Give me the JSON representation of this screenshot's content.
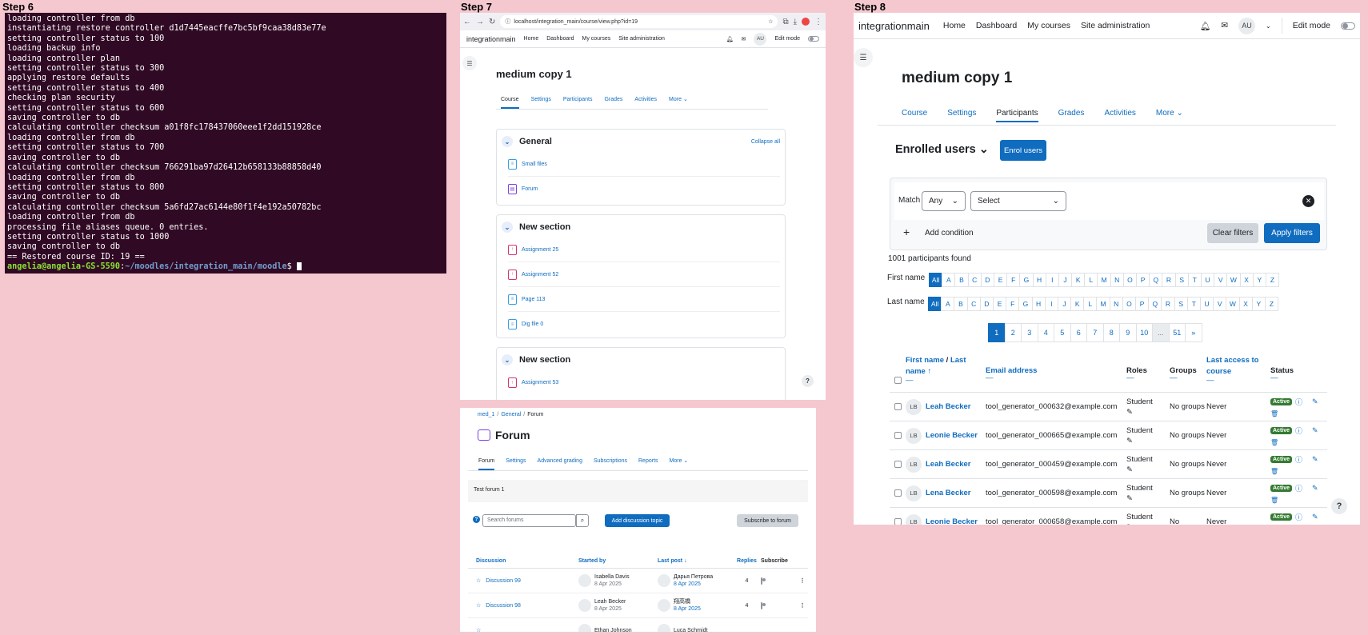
{
  "steps": {
    "s6": "Step 6",
    "s7": "Step 7",
    "s8": "Step 8"
  },
  "terminal": {
    "lines": [
      "loading controller from db",
      "instantiating restore controller d1d7445eacffe7bc5bf9caa38d83e77e",
      "setting controller status to 100",
      "loading backup info",
      "loading controller plan",
      "setting controller status to 300",
      "applying restore defaults",
      "setting controller status to 400",
      "checking plan security",
      "setting controller status to 600",
      "saving controller to db",
      "calculating controller checksum a01f8fc178437060eee1f2dd151928ce",
      "loading controller from db",
      "setting controller status to 700",
      "saving controller to db",
      "calculating controller checksum 766291ba97d26412b658133b88858d40",
      "loading controller from db",
      "setting controller status to 800",
      "saving controller to db",
      "calculating controller checksum 5a6fd27ac6144e80f1f4e192a50782bc",
      "loading controller from db",
      "processing file aliases queue. 0 entries.",
      "setting controller status to 1000",
      "saving controller to db",
      "== Restored course ID: 19 =="
    ],
    "prompt_user": "angelia@angelia-GS-5590",
    "prompt_path": "~/moodles/integration_main/moodle",
    "prompt_symbol": "$"
  },
  "s7": {
    "url": "localhost/integration_main/course/view.php?id=19",
    "nav": {
      "brand": "integrationmain",
      "home": "Home",
      "dashboard": "Dashboard",
      "mycourses": "My courses",
      "siteadmin": "Site administration",
      "avatar": "AU",
      "editmode": "Edit mode"
    },
    "course_title": "medium copy 1",
    "tabs": [
      "Course",
      "Settings",
      "Participants",
      "Grades",
      "Activities",
      "More ⌄"
    ],
    "sections": [
      {
        "title": "General",
        "collapse": "Collapse all",
        "items": [
          "Small files",
          "Forum"
        ]
      },
      {
        "title": "New section",
        "items": [
          "Assignment 25",
          "Assignment 52",
          "Page 113",
          "Dig file 0"
        ]
      },
      {
        "title": "New section",
        "items": [
          "Assignment 53"
        ]
      }
    ],
    "help": "?"
  },
  "s7b": {
    "breadcrumb": [
      "med_1",
      "General",
      "Forum"
    ],
    "title": "Forum",
    "tabs": [
      "Forum",
      "Settings",
      "Advanced grading",
      "Subscriptions",
      "Reports",
      "More ⌄"
    ],
    "description": "Test forum 1",
    "search_placeholder": "Search forums",
    "add_button": "Add discussion topic",
    "subscribe_button": "Subscribe to forum",
    "headers": {
      "discussion": "Discussion",
      "started": "Started by",
      "last": "Last post ↓",
      "replies": "Replies",
      "subscribe": "Subscribe"
    },
    "rows": [
      {
        "discussion": "Discussion 99",
        "starter": "Isabella Davis",
        "start_date": "8 Apr 2025",
        "last_by": "Дарья Петрова",
        "last_date": "8 Apr 2025",
        "replies": "4"
      },
      {
        "discussion": "Discussion 98",
        "starter": "Leah Becker",
        "start_date": "8 Apr 2025",
        "last_by": "翔高橋",
        "last_date": "8 Apr 2025",
        "replies": "4"
      },
      {
        "discussion": "",
        "starter": "Ethan Johnson",
        "start_date": "",
        "last_by": "Luca Schmidt",
        "last_date": "",
        "replies": ""
      }
    ]
  },
  "s8": {
    "nav": {
      "brand": "integrationmain",
      "home": "Home",
      "dashboard": "Dashboard",
      "mycourses": "My courses",
      "siteadmin": "Site administration",
      "avatar": "AU",
      "editmode": "Edit mode"
    },
    "course_title": "medium copy 1",
    "tabs": [
      "Course",
      "Settings",
      "Participants",
      "Grades",
      "Activities",
      "More ⌄"
    ],
    "enrolled_title": "Enrolled users ⌄",
    "enrol_button": "Enrol users",
    "filter": {
      "match_label": "Match",
      "match_value": "Any",
      "select_value": "Select",
      "add_condition": "Add condition",
      "clear": "Clear filters",
      "apply": "Apply filters"
    },
    "found": "1001 participants found",
    "first_name_label": "First name",
    "last_name_label": "Last name",
    "letters": [
      "All",
      "A",
      "B",
      "C",
      "D",
      "E",
      "F",
      "G",
      "H",
      "I",
      "J",
      "K",
      "L",
      "M",
      "N",
      "O",
      "P",
      "Q",
      "R",
      "S",
      "T",
      "U",
      "V",
      "W",
      "X",
      "Y",
      "Z"
    ],
    "pages": [
      "1",
      "2",
      "3",
      "4",
      "5",
      "6",
      "7",
      "8",
      "9",
      "10",
      "...",
      "51",
      "»"
    ],
    "headers": {
      "firstname": "First name",
      "slash": " / ",
      "lastname": "Last name",
      "lastname2": "name ↑",
      "email": "Email address",
      "roles": "Roles",
      "groups": "Groups",
      "lastaccess": "Last access to course",
      "status": "Status",
      "dash": "—"
    },
    "rows": [
      {
        "initials": "LB",
        "name": "Leah Becker",
        "email": "tool_generator_000632@example.com",
        "role": "Student",
        "groups": "No groups",
        "access": "Never",
        "status": "Active"
      },
      {
        "initials": "LB",
        "name": "Leonie Becker",
        "email": "tool_generator_000665@example.com",
        "role": "Student",
        "groups": "No groups",
        "access": "Never",
        "status": "Active"
      },
      {
        "initials": "LB",
        "name": "Leah Becker",
        "email": "tool_generator_000459@example.com",
        "role": "Student",
        "groups": "No groups",
        "access": "Never",
        "status": "Active"
      },
      {
        "initials": "LB",
        "name": "Lena Becker",
        "email": "tool_generator_000598@example.com",
        "role": "Student",
        "groups": "No groups",
        "access": "Never",
        "status": "Active"
      },
      {
        "initials": "LB",
        "name": "Leonie Becker",
        "email": "tool_generator_000658@example.com",
        "role": "Student",
        "groups": "No",
        "access": "Never",
        "status": "Active"
      }
    ],
    "help": "?"
  }
}
